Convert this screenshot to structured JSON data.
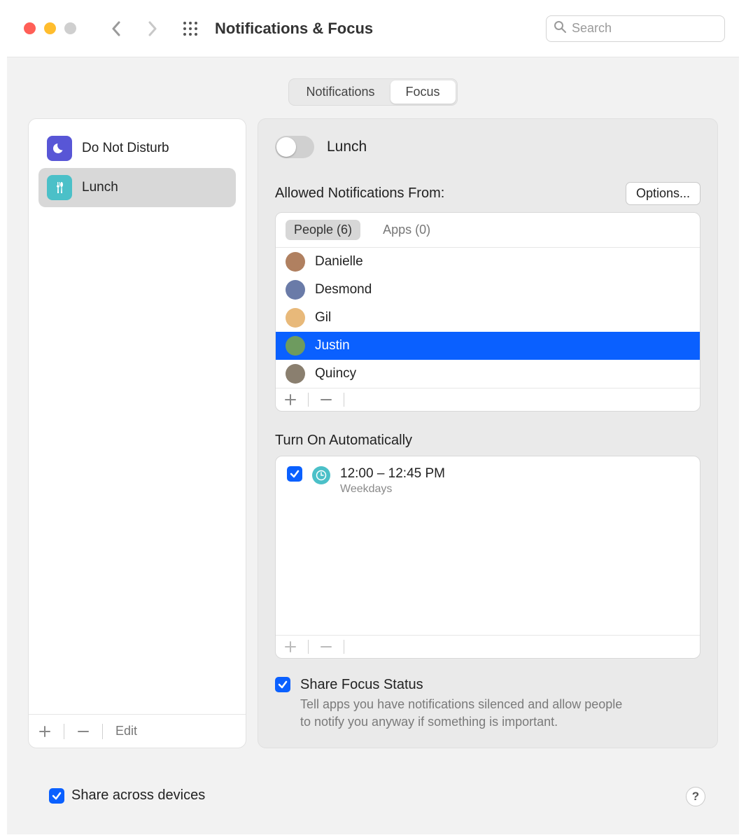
{
  "window": {
    "title": "Notifications & Focus",
    "search_placeholder": "Search"
  },
  "tabs": {
    "notifications": "Notifications",
    "focus": "Focus",
    "active": "focus"
  },
  "sidebar": {
    "items": [
      {
        "label": "Do Not Disturb",
        "icon": "moon",
        "selected": false
      },
      {
        "label": "Lunch",
        "icon": "utensils",
        "selected": true
      }
    ],
    "edit_label": "Edit"
  },
  "detail": {
    "toggle_on": false,
    "name": "Lunch",
    "allowed_title": "Allowed Notifications From:",
    "options_label": "Options...",
    "allowed_tabs": {
      "people": "People (6)",
      "apps": "Apps (0)",
      "active": "people"
    },
    "people": [
      {
        "name": "Danielle",
        "avatar_color": "#b08060",
        "selected": false
      },
      {
        "name": "Desmond",
        "avatar_color": "#6a7ba8",
        "selected": false
      },
      {
        "name": "Gil",
        "avatar_color": "#e8b97a",
        "selected": false
      },
      {
        "name": "Justin",
        "avatar_color": "#6e9b5f",
        "selected": true
      },
      {
        "name": "Quincy",
        "avatar_color": "#8a7f6f",
        "selected": false
      }
    ],
    "auto_title": "Turn On Automatically",
    "schedule": {
      "enabled": true,
      "time": "12:00 – 12:45 PM",
      "days": "Weekdays"
    },
    "share_focus": {
      "enabled": true,
      "title": "Share Focus Status",
      "desc": "Tell apps you have notifications silenced and allow people to notify you anyway if something is important."
    }
  },
  "footer": {
    "share_across_devices": {
      "enabled": true,
      "label": "Share across devices"
    },
    "help": "?"
  }
}
